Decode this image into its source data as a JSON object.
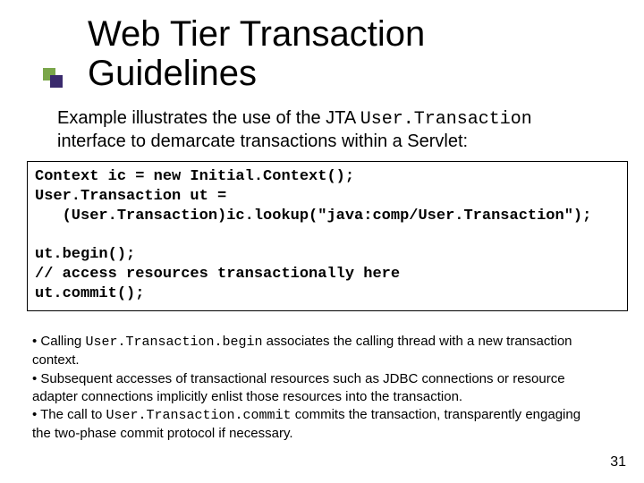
{
  "title": "Web Tier Transaction Guidelines",
  "intro_pre": "Example illustrates the use of the JTA ",
  "intro_code": "User.Transaction",
  "intro_post": " interface to demarcate transactions within a Servlet:",
  "code": "Context ic = new Initial.Context();\nUser.Transaction ut =\n   (User.Transaction)ic.lookup(\"java:comp/User.Transaction\");\n\nut.begin();\n// access resources transactionally here\nut.commit();",
  "notes": {
    "b1_pre": "• Calling ",
    "b1_code": "User.Transaction.begin",
    "b1_post": " associates the calling thread with a new transaction context.",
    "b2": "• Subsequent accesses of transactional resources such as JDBC connections or resource adapter connections implicitly enlist those resources into the transaction.",
    "b3_pre": "• The call to ",
    "b3_code": "User.Transaction.commit",
    "b3_post": " commits the transaction, transparently engaging the two-phase commit protocol if necessary."
  },
  "page_number": "31"
}
